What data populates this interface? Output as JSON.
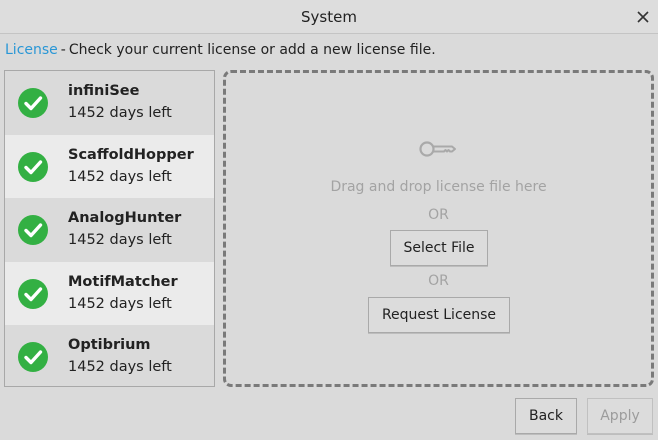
{
  "window": {
    "title": "System"
  },
  "header": {
    "section": "License",
    "separator": "-",
    "description": "Check your current license or add a new license file."
  },
  "licenses": [
    {
      "name": "infiniSee",
      "days": "1452 days left"
    },
    {
      "name": "ScaffoldHopper",
      "days": "1452 days left"
    },
    {
      "name": "AnalogHunter",
      "days": "1452 days left"
    },
    {
      "name": "MotifMatcher",
      "days": "1452 days left"
    },
    {
      "name": "Optibrium",
      "days": "1452 days left"
    }
  ],
  "dropzone": {
    "hint": "Drag and drop license file here",
    "or1": "OR",
    "select_label": "Select File",
    "or2": "OR",
    "request_label": "Request License"
  },
  "footer": {
    "back_label": "Back",
    "apply_label": "Apply"
  },
  "colors": {
    "accent": "#2a97d6",
    "check": "#33b043"
  }
}
